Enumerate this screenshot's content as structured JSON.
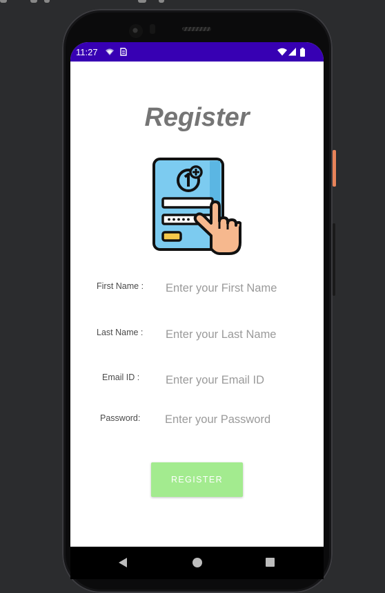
{
  "status_bar": {
    "time": "11:27",
    "background_color": "#3700b3",
    "left_icons": [
      "wifi-calling-icon",
      "sim-card-icon"
    ],
    "right_icons": [
      "wifi-icon",
      "cell-signal-icon",
      "battery-icon"
    ]
  },
  "page": {
    "title": "Register",
    "illustration": "register-form-hand-icon"
  },
  "form": {
    "first_name": {
      "label": "First Name :",
      "placeholder": "Enter your First Name",
      "value": ""
    },
    "last_name": {
      "label": "Last Name :",
      "placeholder": "Enter your Last Name",
      "value": ""
    },
    "email": {
      "label": "Email ID :",
      "placeholder": "Enter your Email ID",
      "value": ""
    },
    "password": {
      "label": "Password:",
      "placeholder": "Enter your Password",
      "value": ""
    }
  },
  "register_button": {
    "label": "REGISTER",
    "color": "#a3eb8f"
  },
  "nav_bar": {
    "icons": [
      "back-icon",
      "home-icon",
      "recents-icon"
    ]
  }
}
